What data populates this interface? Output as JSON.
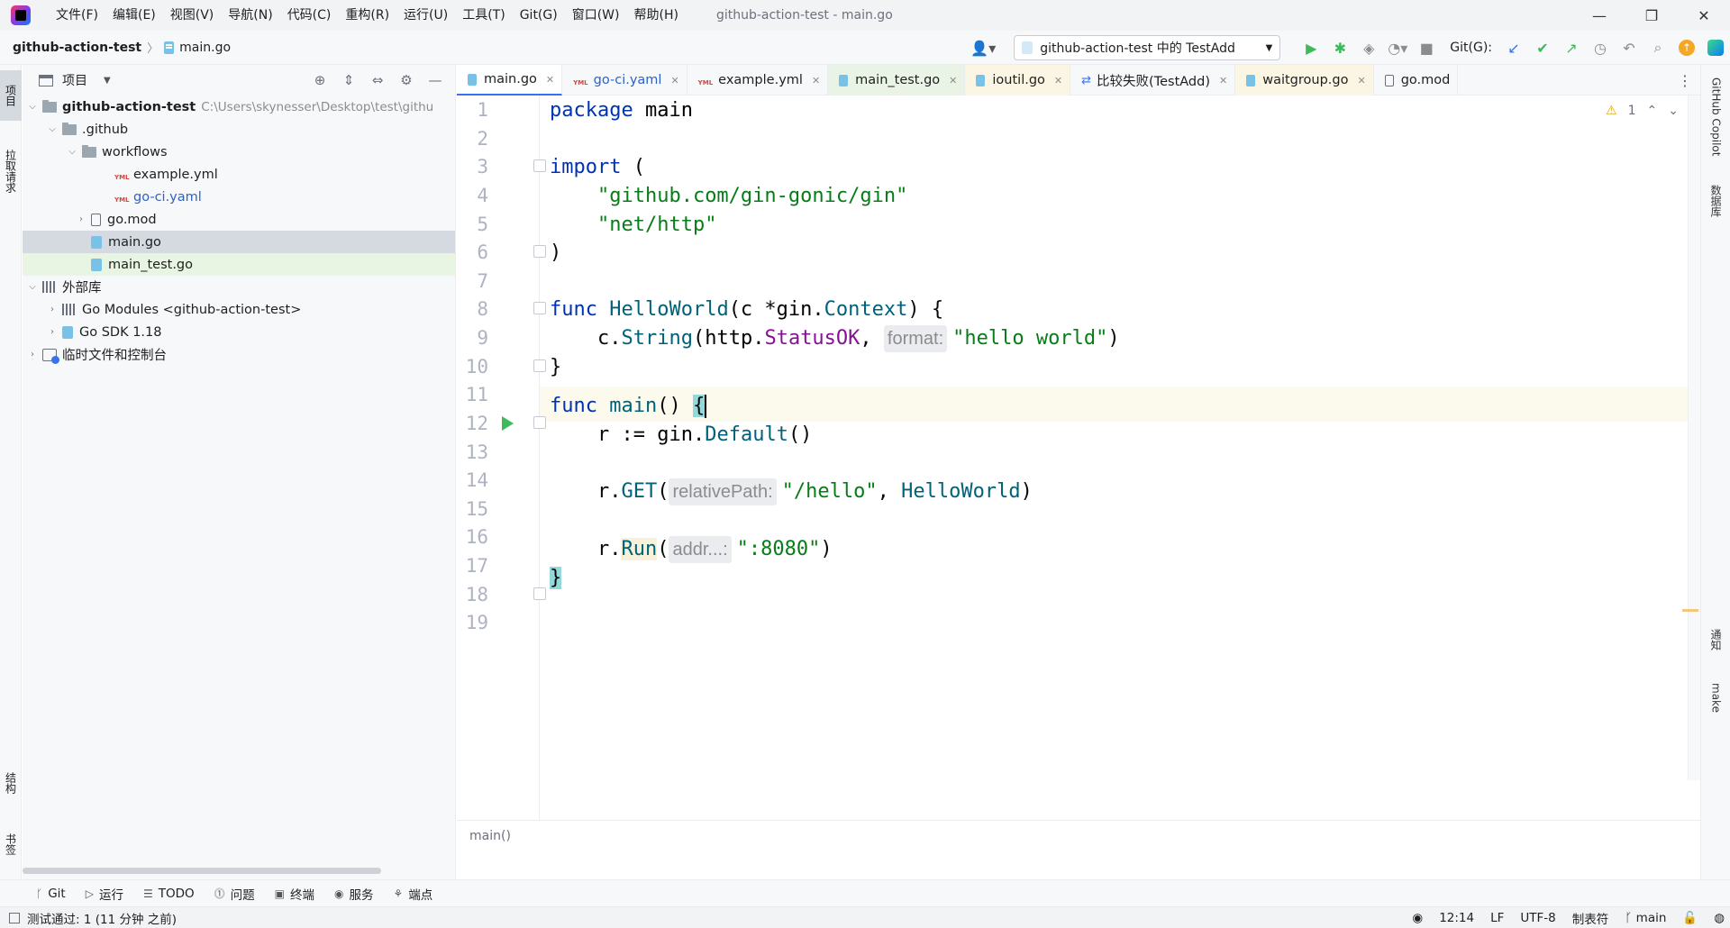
{
  "window": {
    "title": "github-action-test - main.go",
    "menu": [
      "文件(F)",
      "编辑(E)",
      "视图(V)",
      "导航(N)",
      "代码(C)",
      "重构(R)",
      "运行(U)",
      "工具(T)",
      "Git(G)",
      "窗口(W)",
      "帮助(H)"
    ],
    "controls": {
      "minimize": "—",
      "restore": "❐",
      "close": "✕"
    }
  },
  "navbar": {
    "project": "github-action-test",
    "file": "main.go",
    "run_config": "github-action-test 中的 TestAdd",
    "git_label": "Git(G):"
  },
  "left_stripe": {
    "project": "项目",
    "pull_requests": "拉取请求",
    "structure": "结构",
    "bookmarks": "书签"
  },
  "project_panel": {
    "title": "项目",
    "tree": [
      {
        "label": "github-action-test",
        "path": "C:\\Users\\skynesser\\Desktop\\test\\githu"
      },
      {
        "label": ".github"
      },
      {
        "label": "workflows"
      },
      {
        "label": "example.yml"
      },
      {
        "label": "go-ci.yaml"
      },
      {
        "label": "go.mod"
      },
      {
        "label": "main.go"
      },
      {
        "label": "main_test.go"
      },
      {
        "label": "外部库"
      },
      {
        "label": "Go Modules <github-action-test>"
      },
      {
        "label": "Go SDK 1.18"
      },
      {
        "label": "临时文件和控制台"
      }
    ]
  },
  "tabs": [
    {
      "label": "main.go",
      "active": true
    },
    {
      "label": "go-ci.yaml"
    },
    {
      "label": "example.yml"
    },
    {
      "label": "main_test.go"
    },
    {
      "label": "ioutil.go"
    },
    {
      "label": "比较失败(TestAdd)"
    },
    {
      "label": "waitgroup.go"
    },
    {
      "label": "go.mod"
    }
  ],
  "editor": {
    "warnings": "1",
    "line_numbers": [
      "1",
      "2",
      "3",
      "4",
      "5",
      "6",
      "7",
      "8",
      "9",
      "10",
      "11",
      "12",
      "13",
      "14",
      "15",
      "16",
      "17",
      "18",
      "19"
    ],
    "code": {
      "l1_kw": "package",
      "l1_name": "main",
      "l3_kw": "import",
      "l3_paren": "(",
      "l4_str": "\"github.com/gin-gonic/gin\"",
      "l5_str": "\"net/http\"",
      "l6_paren": ")",
      "l8_kw": "func",
      "l8_fn": "HelloWorld",
      "l8_args_a": "(c *",
      "l8_pkg": "gin",
      "l8_dot": ".",
      "l8_type": "Context",
      "l8_end": ") {",
      "l9_a": "c.",
      "l9_call": "String",
      "l9_b": "(",
      "l9_pkg": "http",
      "l9_dot": ".",
      "l9_const": "StatusOK",
      "l9_c": ", ",
      "l9_hint": "format:",
      "l9_str": "\"hello world\"",
      "l9_end": ")",
      "l10": "}",
      "l12_kw": "func",
      "l12_fn": "main",
      "l12_paren": "() ",
      "l12_brace": "{",
      "l13_a": "r := ",
      "l13_pkg": "gin",
      "l13_dot": ".",
      "l13_call": "Default",
      "l13_end": "()",
      "l15_a": "r.",
      "l15_call": "GET",
      "l15_b": "(",
      "l15_hint": "relativePath:",
      "l15_str": "\"/hello\"",
      "l15_c": ", ",
      "l15_ref": "HelloWorld",
      "l15_end": ")",
      "l17_a": "r.",
      "l17_call": "Run",
      "l17_b": "(",
      "l17_hint": "addr...:",
      "l17_str": "\":8080\"",
      "l17_end": ")",
      "l18_brace": "}"
    },
    "breadcrumb": "main()"
  },
  "right_stripe": {
    "copilot": "GitHub Copilot",
    "database": "数据库",
    "notifications": "通知",
    "make": "make"
  },
  "bottom_tools": [
    {
      "label": "Git",
      "icon": "git-branch-icon"
    },
    {
      "label": "运行",
      "icon": "run-icon"
    },
    {
      "label": "TODO",
      "icon": "todo-icon"
    },
    {
      "label": "问题",
      "icon": "problems-icon"
    },
    {
      "label": "终端",
      "icon": "terminal-icon"
    },
    {
      "label": "服务",
      "icon": "services-icon"
    },
    {
      "label": "端点",
      "icon": "endpoints-icon"
    }
  ],
  "status": {
    "message": "测试通过: 1 (11 分钟 之前)",
    "position": "12:14",
    "line_sep": "LF",
    "encoding": "UTF-8",
    "indent": "制表符",
    "branch": "main"
  },
  "colors": {
    "accent": "#3574f0",
    "run_green": "#3dbb5a",
    "keyword": "#0033b3",
    "string": "#067d17",
    "function": "#00627a",
    "constant": "#871094"
  }
}
